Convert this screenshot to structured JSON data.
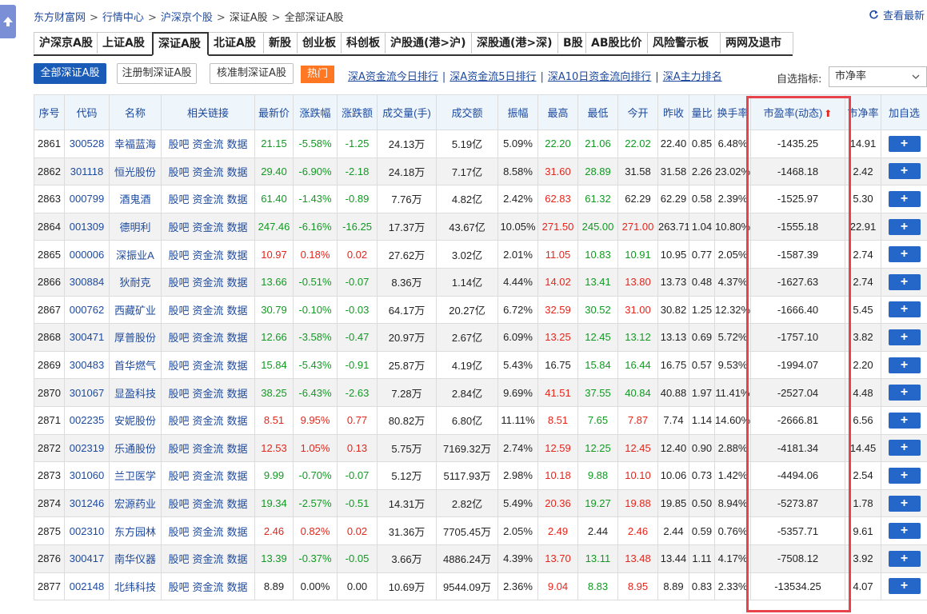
{
  "breadcrumb": [
    "东方财富网",
    "行情中心",
    "沪深京个股",
    "深证A股",
    "全部深证A股"
  ],
  "breadcrumb_sep": ">",
  "refresh_label": "查看最新",
  "tabs": [
    {
      "label": "沪深京A股",
      "w": 80
    },
    {
      "label": "上证A股",
      "w": 70
    },
    {
      "label": "深证A股",
      "w": 71,
      "active": true
    },
    {
      "label": "北证A股",
      "w": 70
    },
    {
      "label": "新股",
      "w": 43
    },
    {
      "label": "创业板",
      "w": 56
    },
    {
      "label": "科创板",
      "w": 56
    },
    {
      "label": "沪股通(港>沪)",
      "w": 109
    },
    {
      "label": "深股通(港>深)",
      "w": 109
    },
    {
      "label": "B股",
      "w": 36
    },
    {
      "label": "AB股比价",
      "w": 78
    },
    {
      "label": "风险警示板",
      "w": 92
    },
    {
      "label": "两网及退市",
      "w": 92
    }
  ],
  "toolbar": {
    "btn_all": "全部深证A股",
    "btn_reg": "注册制深证A股",
    "btn_approve": "核准制深证A股",
    "hot_label": "热门",
    "links": [
      "深A资金流今日排行",
      "深A资金流5日排行",
      "深A10日资金流向排行",
      "深A主力排名"
    ],
    "pick_label": "自选指标:",
    "pick_value": "市净率"
  },
  "columns": [
    "序号",
    "代码",
    "名称",
    "相关链接",
    "最新价",
    "涨跌幅",
    "涨跌额",
    "成交量(手)",
    "成交额",
    "振幅",
    "最高",
    "最低",
    "今开",
    "昨收",
    "量比",
    "换手率",
    "市盈率(动态)",
    "市净率",
    "加自选"
  ],
  "link_labels": [
    "股吧",
    "资金流",
    "数据"
  ],
  "rows": [
    [
      "2861",
      "300528",
      "幸福蓝海",
      "21.15",
      "-5.58%",
      "-1.25",
      "24.13万",
      "5.19亿",
      "5.09%",
      "22.20",
      "21.06",
      "22.02",
      "22.40",
      "0.85",
      "6.48%",
      "-1435.25",
      "14.91"
    ],
    [
      "2862",
      "301118",
      "恒光股份",
      "29.40",
      "-6.90%",
      "-2.18",
      "24.18万",
      "7.17亿",
      "8.58%",
      "31.60",
      "28.89",
      "31.58",
      "31.58",
      "2.26",
      "23.02%",
      "-1468.18",
      "2.42"
    ],
    [
      "2863",
      "000799",
      "酒鬼酒",
      "61.40",
      "-1.43%",
      "-0.89",
      "7.76万",
      "4.82亿",
      "2.42%",
      "62.83",
      "61.32",
      "62.29",
      "62.29",
      "0.58",
      "2.39%",
      "-1525.97",
      "5.30"
    ],
    [
      "2864",
      "001309",
      "德明利",
      "247.46",
      "-6.16%",
      "-16.25",
      "17.37万",
      "43.67亿",
      "10.05%",
      "271.50",
      "245.00",
      "271.00",
      "263.71",
      "1.04",
      "10.80%",
      "-1555.18",
      "22.91"
    ],
    [
      "2865",
      "000006",
      "深振业A",
      "10.97",
      "0.18%",
      "0.02",
      "27.62万",
      "3.02亿",
      "2.01%",
      "11.05",
      "10.83",
      "10.91",
      "10.95",
      "0.77",
      "2.05%",
      "-1587.39",
      "2.74"
    ],
    [
      "2866",
      "300884",
      "狄耐克",
      "13.66",
      "-0.51%",
      "-0.07",
      "8.36万",
      "1.14亿",
      "4.44%",
      "14.02",
      "13.41",
      "13.80",
      "13.73",
      "0.48",
      "4.37%",
      "-1627.63",
      "2.74"
    ],
    [
      "2867",
      "000762",
      "西藏矿业",
      "30.79",
      "-0.10%",
      "-0.03",
      "64.17万",
      "20.27亿",
      "6.72%",
      "32.59",
      "30.52",
      "31.00",
      "30.82",
      "1.25",
      "12.32%",
      "-1666.40",
      "5.45"
    ],
    [
      "2868",
      "300471",
      "厚普股份",
      "12.66",
      "-3.58%",
      "-0.47",
      "20.97万",
      "2.67亿",
      "6.09%",
      "13.25",
      "12.45",
      "13.12",
      "13.13",
      "0.69",
      "5.72%",
      "-1757.10",
      "3.82"
    ],
    [
      "2869",
      "300483",
      "首华燃气",
      "15.84",
      "-5.43%",
      "-0.91",
      "25.87万",
      "4.19亿",
      "5.43%",
      "16.75",
      "15.84",
      "16.44",
      "16.75",
      "0.57",
      "9.53%",
      "-1994.07",
      "2.20"
    ],
    [
      "2870",
      "301067",
      "显盈科技",
      "38.25",
      "-6.43%",
      "-2.63",
      "7.28万",
      "2.84亿",
      "9.69%",
      "41.51",
      "37.55",
      "40.84",
      "40.88",
      "1.97",
      "11.41%",
      "-2527.04",
      "4.48"
    ],
    [
      "2871",
      "002235",
      "安妮股份",
      "8.51",
      "9.95%",
      "0.77",
      "80.82万",
      "6.80亿",
      "11.11%",
      "8.51",
      "7.65",
      "7.87",
      "7.74",
      "1.14",
      "14.60%",
      "-2666.81",
      "6.56"
    ],
    [
      "2872",
      "002319",
      "乐通股份",
      "12.53",
      "1.05%",
      "0.13",
      "5.75万",
      "7169.32万",
      "2.74%",
      "12.59",
      "12.25",
      "12.45",
      "12.40",
      "0.90",
      "2.88%",
      "-4181.34",
      "14.45"
    ],
    [
      "2873",
      "301060",
      "兰卫医学",
      "9.99",
      "-0.70%",
      "-0.07",
      "5.12万",
      "5117.93万",
      "2.98%",
      "10.18",
      "9.88",
      "10.10",
      "10.06",
      "0.73",
      "1.42%",
      "-4494.06",
      "2.54"
    ],
    [
      "2874",
      "301246",
      "宏源药业",
      "19.34",
      "-2.57%",
      "-0.51",
      "14.31万",
      "2.82亿",
      "5.49%",
      "20.36",
      "19.27",
      "19.88",
      "19.85",
      "0.50",
      "8.94%",
      "-5273.87",
      "1.78"
    ],
    [
      "2875",
      "002310",
      "东方园林",
      "2.46",
      "0.82%",
      "0.02",
      "31.36万",
      "7705.45万",
      "2.05%",
      "2.49",
      "2.44",
      "2.46",
      "2.44",
      "0.59",
      "0.76%",
      "-5357.71",
      "9.61"
    ],
    [
      "2876",
      "300417",
      "南华仪器",
      "13.39",
      "-0.37%",
      "-0.05",
      "3.66万",
      "4886.24万",
      "4.39%",
      "13.70",
      "13.11",
      "13.48",
      "13.44",
      "1.11",
      "4.17%",
      "-7508.12",
      "3.92"
    ],
    [
      "2877",
      "002148",
      "北纬科技",
      "8.89",
      "0.00%",
      "0.00",
      "10.69万",
      "9544.09万",
      "2.36%",
      "9.04",
      "8.83",
      "8.95",
      "8.89",
      "0.83",
      "2.33%",
      "-13534.25",
      "4.07"
    ]
  ],
  "colors": {
    "up": "#e5251b",
    "down": "#119a22",
    "link": "#1d4a9e",
    "header_bg": "#eef5fb",
    "highlight": "#e8434a",
    "add_btn": "#2467c8"
  }
}
